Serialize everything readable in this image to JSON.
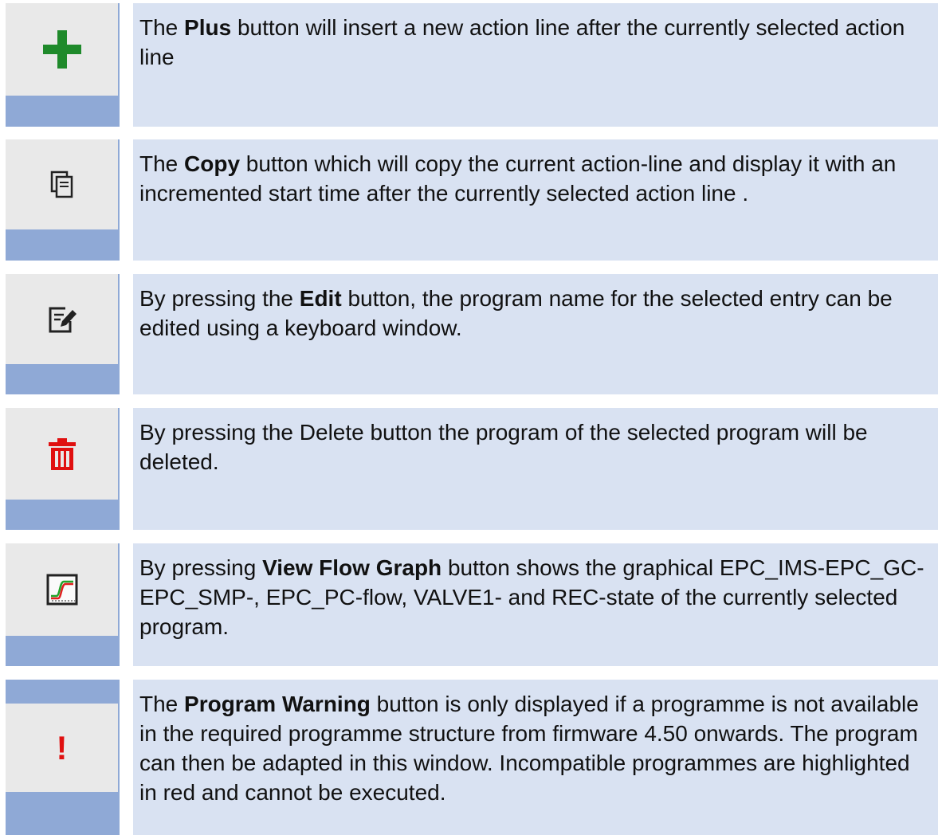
{
  "rows": [
    {
      "icon": "plus-icon",
      "pre": "The ",
      "bold": "Plus",
      "post": " button  will insert a new action line after the currently selected action line"
    },
    {
      "icon": "copy-icon",
      "pre": "The ",
      "bold": "Copy",
      "post": " button which will copy the current action-line and display it with an incremented start time after the currently selected action line ."
    },
    {
      "icon": "edit-icon",
      "pre": "By pressing the ",
      "bold": "Edit",
      "post": " button, the program name for the selected entry can be edited using a keyboard window."
    },
    {
      "icon": "trash-icon",
      "pre": "By pressing the Delete button the program of the selected program will be deleted.",
      "bold": "",
      "post": ""
    },
    {
      "icon": "flow-graph-icon",
      "pre": "By pressing ",
      "bold": "View Flow Graph",
      "post": " button shows the graphical EPC_IMS-EPC_GC- EPC_SMP-, EPC_PC-flow, VALVE1- and REC-state of the currently selected program."
    },
    {
      "icon": "warning-icon",
      "pre": "The ",
      "bold": "Program Warning",
      "post": " button is only displayed if a programme is not available in the required programme structure from firmware 4.50 onwards. The program can then be adapted in this window. Incompatible programmes are highlighted in red and cannot be executed."
    }
  ],
  "colors": {
    "plus": "#1f8a2b",
    "trash": "#e01010",
    "warning": "#e01010",
    "graph_green": "#22a52a",
    "graph_red": "#e02020"
  },
  "warning_glyph": "!"
}
